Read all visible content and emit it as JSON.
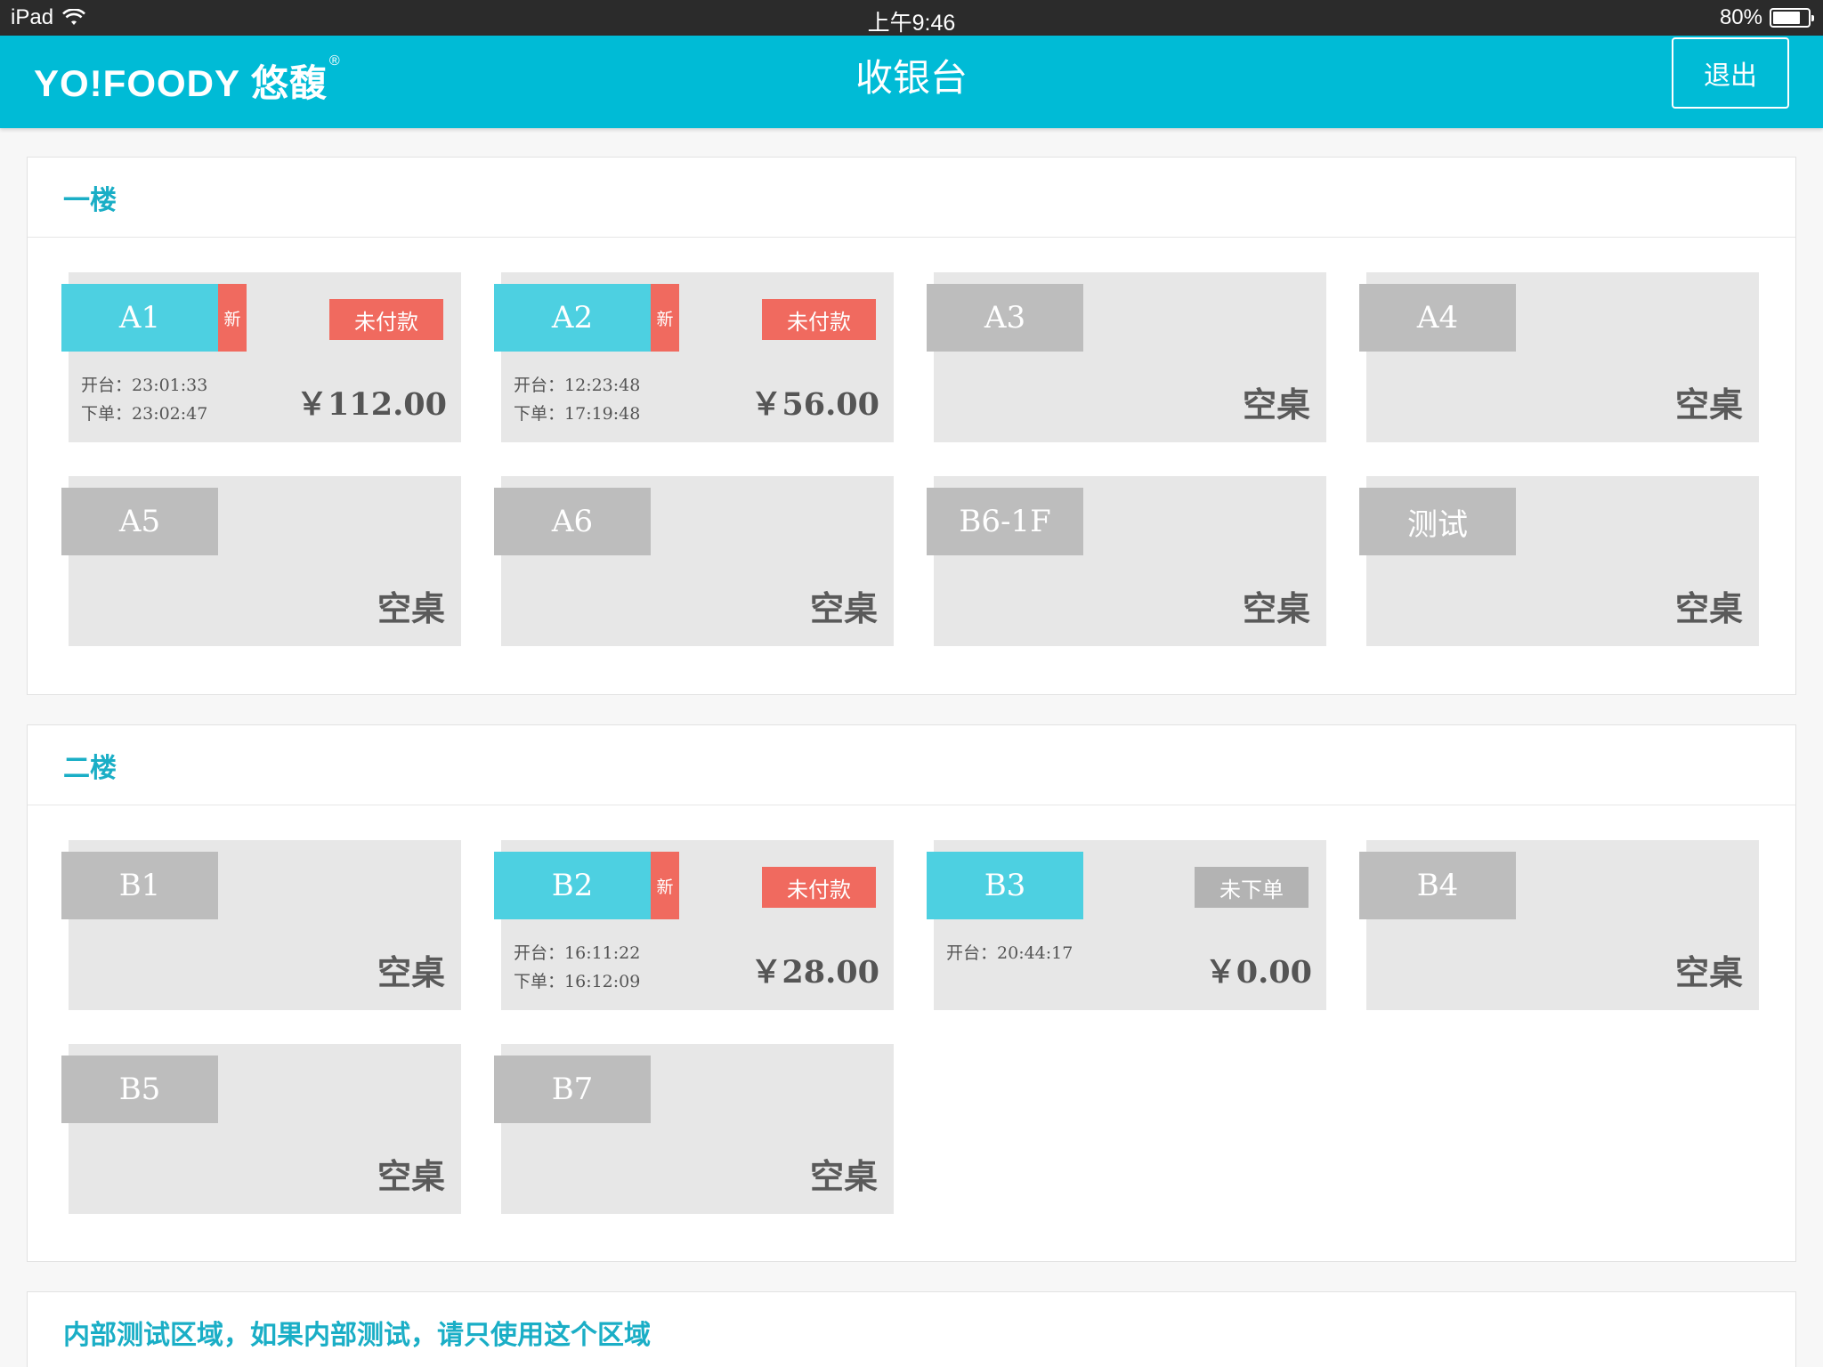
{
  "statusbar": {
    "device": "iPad",
    "time": "上午9:46",
    "battery": "80%",
    "battery_level": 0.8
  },
  "header": {
    "logo": "YO!FOODY 悠馥",
    "logo_mark": "®",
    "title": "收银台",
    "logout": "退出"
  },
  "sections": [
    {
      "title": "一楼",
      "tables": [
        {
          "name": "A1",
          "active": true,
          "new_badge": "新",
          "status": "未付款",
          "open_label": "开台：",
          "open_time": "23:01:33",
          "order_label": "下单：",
          "order_time": "23:02:47",
          "amount": "￥112.00"
        },
        {
          "name": "A2",
          "active": true,
          "new_badge": "新",
          "status": "未付款",
          "open_label": "开台：",
          "open_time": "12:23:48",
          "order_label": "下单：",
          "order_time": "17:19:48",
          "amount": "￥56.00"
        },
        {
          "name": "A3",
          "empty": "空桌"
        },
        {
          "name": "A4",
          "empty": "空桌"
        },
        {
          "name": "A5",
          "empty": "空桌"
        },
        {
          "name": "A6",
          "empty": "空桌"
        },
        {
          "name": "B6-1F",
          "empty": "空桌"
        },
        {
          "name": "测试",
          "empty": "空桌"
        }
      ]
    },
    {
      "title": "二楼",
      "tables": [
        {
          "name": "B1",
          "empty": "空桌"
        },
        {
          "name": "B2",
          "active": true,
          "new_badge": "新",
          "status": "未付款",
          "open_label": "开台：",
          "open_time": "16:11:22",
          "order_label": "下单：",
          "order_time": "16:12:09",
          "amount": "￥28.00"
        },
        {
          "name": "B3",
          "active": true,
          "status": "未下单",
          "status_style": "grey",
          "open_label": "开台：",
          "open_time": "20:44:17",
          "amount": "￥0.00"
        },
        {
          "name": "B4",
          "empty": "空桌"
        },
        {
          "name": "B5",
          "empty": "空桌"
        },
        {
          "name": "B7",
          "empty": "空桌"
        }
      ]
    },
    {
      "title": "内部测试区域，如果内部测试，请只使用这个区域",
      "tables": []
    }
  ]
}
